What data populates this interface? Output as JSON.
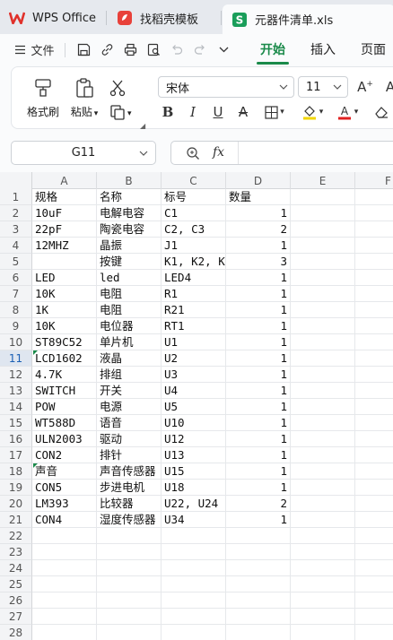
{
  "tabs": [
    {
      "label": "WPS Office",
      "icon": "wps-logo-icon"
    },
    {
      "label": "找稻壳模板",
      "icon": "docer-logo-icon"
    },
    {
      "label": "元器件清单.xls",
      "icon": "spreadsheet-file-icon"
    }
  ],
  "menu": {
    "file_label": "文件",
    "tabs": [
      "开始",
      "插入",
      "页面"
    ],
    "active_tab": "开始"
  },
  "ribbon": {
    "format_painter": "格式刷",
    "paste": "粘贴",
    "font_name": "宋体",
    "font_size": "11"
  },
  "formula_bar": {
    "cell_ref": "G11",
    "fx_label": "fx",
    "content": ""
  },
  "sheet": {
    "columns": [
      "A",
      "B",
      "C",
      "D",
      "E",
      "F"
    ],
    "selected_column": "",
    "selected_row": 11,
    "row_numbers": [
      1,
      2,
      3,
      4,
      5,
      6,
      7,
      8,
      9,
      10,
      11,
      12,
      13,
      14,
      15,
      16,
      17,
      18,
      19,
      20,
      21,
      22,
      23,
      24,
      25,
      26,
      27,
      28
    ],
    "rows": [
      [
        "规格",
        "名称",
        "标号",
        "数量"
      ],
      [
        "10uF",
        "电解电容",
        "C1",
        "1"
      ],
      [
        "22pF",
        "陶瓷电容",
        "C2, C3",
        "2"
      ],
      [
        "12MHZ",
        "晶振",
        "J1",
        "1"
      ],
      [
        "",
        "按键",
        "K1, K2, K",
        "3"
      ],
      [
        "LED",
        "led",
        "LED4",
        "1"
      ],
      [
        "10K",
        "电阻",
        "R1",
        "1"
      ],
      [
        "1K",
        "电阻",
        "R21",
        "1"
      ],
      [
        "10K",
        "电位器",
        "RT1",
        "1"
      ],
      [
        "ST89C52",
        "单片机",
        "U1",
        "1"
      ],
      [
        "LCD1602",
        "液晶",
        "U2",
        "1"
      ],
      [
        "4.7K",
        "排组",
        "U3",
        "1"
      ],
      [
        "SWITCH",
        "开关",
        "U4",
        "1"
      ],
      [
        "POW",
        "电源",
        "U5",
        "1"
      ],
      [
        "WT588D",
        "语音",
        "U10",
        "1"
      ],
      [
        "ULN2003",
        "驱动",
        "U12",
        "1"
      ],
      [
        "CON2",
        "排针",
        "U13",
        "1"
      ],
      [
        "声音",
        "声音传感器",
        "U15",
        "1"
      ],
      [
        "CON5",
        "步进电机",
        "U18",
        "1"
      ],
      [
        "LM393",
        "比较器",
        "U22, U24",
        "2"
      ],
      [
        "CON4",
        "湿度传感器",
        "U34",
        "1"
      ]
    ],
    "green_marker_rows": [
      11,
      18
    ]
  }
}
